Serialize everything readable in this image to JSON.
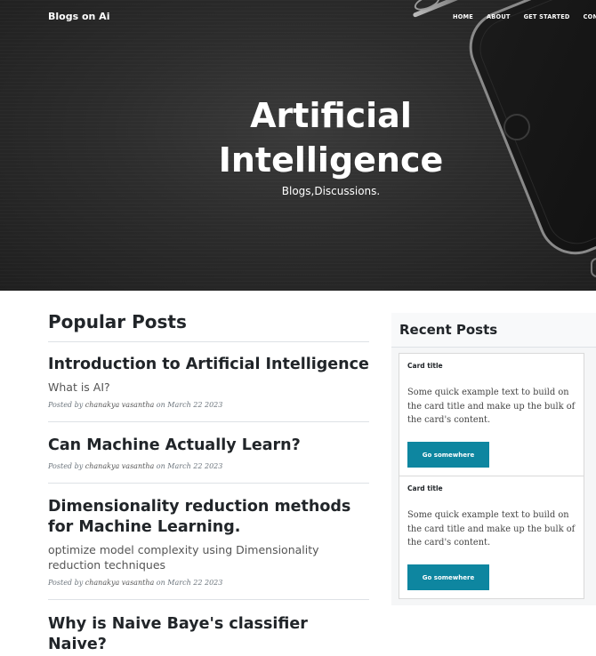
{
  "navbar": {
    "brand": "Blogs on Ai",
    "links": [
      "HOME",
      "ABOUT",
      "GET STARTED",
      "CONTACT"
    ]
  },
  "hero": {
    "title_line1": "Artificial",
    "title_line2": "Intelligence",
    "subtitle": "Blogs,Discussions."
  },
  "popular": {
    "heading": "Popular Posts",
    "posts": [
      {
        "title": "Introduction to Artificial Intelligence",
        "subtitle": "What is AI?",
        "meta_prefix": "Posted by",
        "author": "chanakya vasantha",
        "meta_on": "on March 22 2023"
      },
      {
        "title": "Can Machine Actually Learn?",
        "meta_prefix": "Posted by",
        "author": "chanakya vasantha",
        "meta_on": "on March 22 2023"
      },
      {
        "title": "Dimensionality reduction methods for Machine Learning.",
        "subtitle": "optimize model complexity using Dimensionality reduction techniques",
        "meta_prefix": "Posted by",
        "author": "chanakya vasantha",
        "meta_on": "on March 22 2023"
      },
      {
        "title": "Why is Naive Baye's classifier Naive?"
      }
    ]
  },
  "recent": {
    "heading": "Recent Posts",
    "cards": [
      {
        "title": "Card title",
        "text": "Some quick example text to build on the card title and make up the bulk of the card's content.",
        "button": "Go somewhere"
      },
      {
        "title": "Card title",
        "text": "Some quick example text to build on the card title and make up the bulk of the card's content.",
        "button": "Go somewhere"
      }
    ]
  }
}
